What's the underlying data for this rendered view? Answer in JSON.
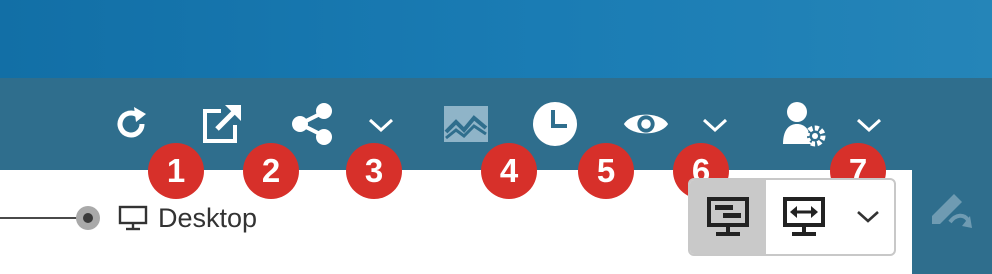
{
  "toolbar": {
    "icons": [
      {
        "name": "refresh-icon"
      },
      {
        "name": "open-new-window-icon"
      },
      {
        "name": "share-icon"
      },
      {
        "name": "chevron-down-icon"
      },
      {
        "name": "chart-area-icon"
      },
      {
        "name": "clock-icon"
      },
      {
        "name": "eye-icon"
      },
      {
        "name": "chevron-down-icon"
      },
      {
        "name": "user-settings-icon"
      },
      {
        "name": "chevron-down-icon"
      }
    ]
  },
  "badges": [
    "1",
    "2",
    "3",
    "4",
    "5",
    "6",
    "7"
  ],
  "device": {
    "label": "Desktop",
    "icon": "monitor-icon"
  },
  "view_toggle": {
    "options": [
      "desktop-layout-icon",
      "fit-width-icon",
      "chevron-down-icon"
    ],
    "selected": "desktop-layout-icon"
  },
  "edit": {
    "icon": "edit-pen-icon"
  },
  "colors": {
    "top_band": "#1a7cb4",
    "toolbar": "#2f6e8d",
    "badge": "#d7302a",
    "content": "#ffffff"
  }
}
